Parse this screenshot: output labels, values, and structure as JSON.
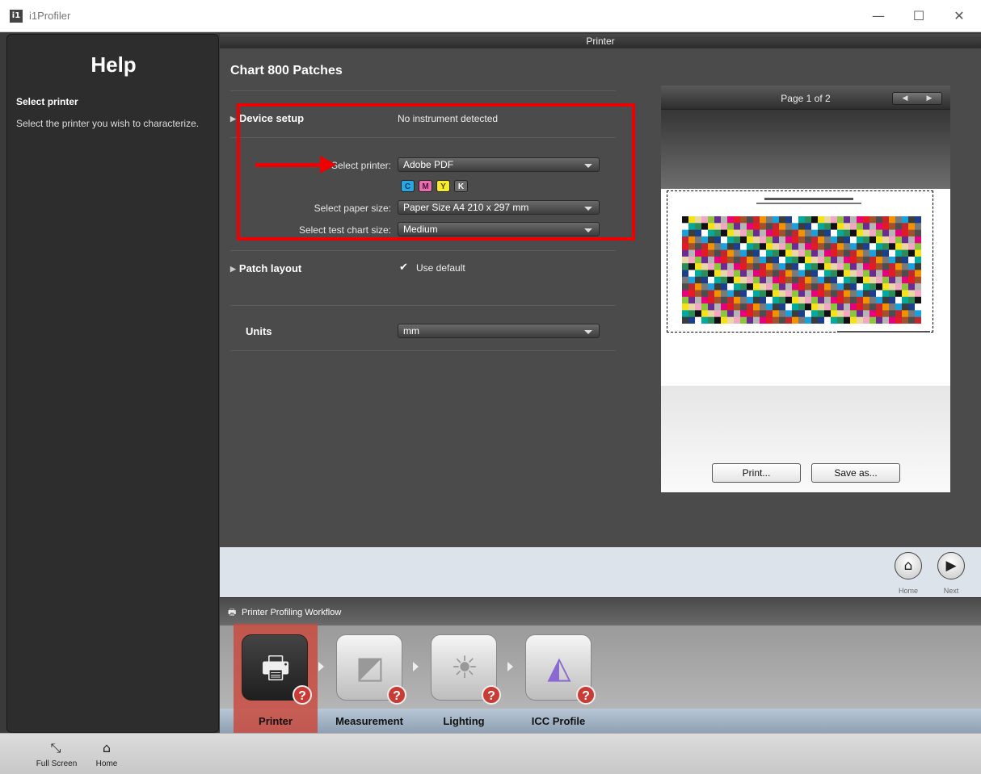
{
  "window": {
    "title": "i1Profiler",
    "icon_label": "i1",
    "minimize": "—",
    "maximize": "☐",
    "close": "✕"
  },
  "help": {
    "title": "Help",
    "heading": "Select printer",
    "text": "Select the printer you wish to characterize."
  },
  "header": {
    "title": "Printer"
  },
  "main": {
    "chart_title": "Chart 800 Patches",
    "device_setup": {
      "label": "Device setup",
      "status": "No instrument detected"
    },
    "select_printer": {
      "label": "Select printer:",
      "value": "Adobe PDF"
    },
    "inks": [
      {
        "label": "C",
        "color": "#29a7e1"
      },
      {
        "label": "M",
        "color": "#e76fb0"
      },
      {
        "label": "Y",
        "color": "#f6ea2a"
      },
      {
        "label": "K",
        "color": "#5a5a5a"
      }
    ],
    "select_paper_size": {
      "label": "Select paper size:",
      "value": "Paper Size A4  210 x 297 mm"
    },
    "select_test_chart_size": {
      "label": "Select test chart size:",
      "value": "Medium"
    },
    "patch_layout": {
      "label": "Patch layout",
      "checkbox_label": "Use default",
      "checked": true
    },
    "units": {
      "label": "Units",
      "value": "mm"
    }
  },
  "preview": {
    "page_label": "Page 1 of 2",
    "prev_icon": "◀",
    "next_icon": "▶",
    "print_button": "Print...",
    "save_button": "Save as..."
  },
  "nav": {
    "home_label": "Home",
    "next_label": "Next",
    "home_icon": "⌂",
    "next_icon": "▶"
  },
  "workflow": {
    "title": "Printer Profiling Workflow",
    "steps": [
      {
        "label": "Printer",
        "icon": "printer-icon",
        "glyph": "🖶"
      },
      {
        "label": "Measurement",
        "icon": "measurement-icon",
        "glyph": "◩"
      },
      {
        "label": "Lighting",
        "icon": "lighting-icon",
        "glyph": "☀"
      },
      {
        "label": "ICC Profile",
        "icon": "icc-profile-icon",
        "glyph": "◭"
      }
    ],
    "badge": "?"
  },
  "bottombar": {
    "full_screen": "Full Screen",
    "home": "Home",
    "full_screen_icon": "⤡",
    "home_icon": "⌂"
  },
  "annotation_color": "#ee0000"
}
